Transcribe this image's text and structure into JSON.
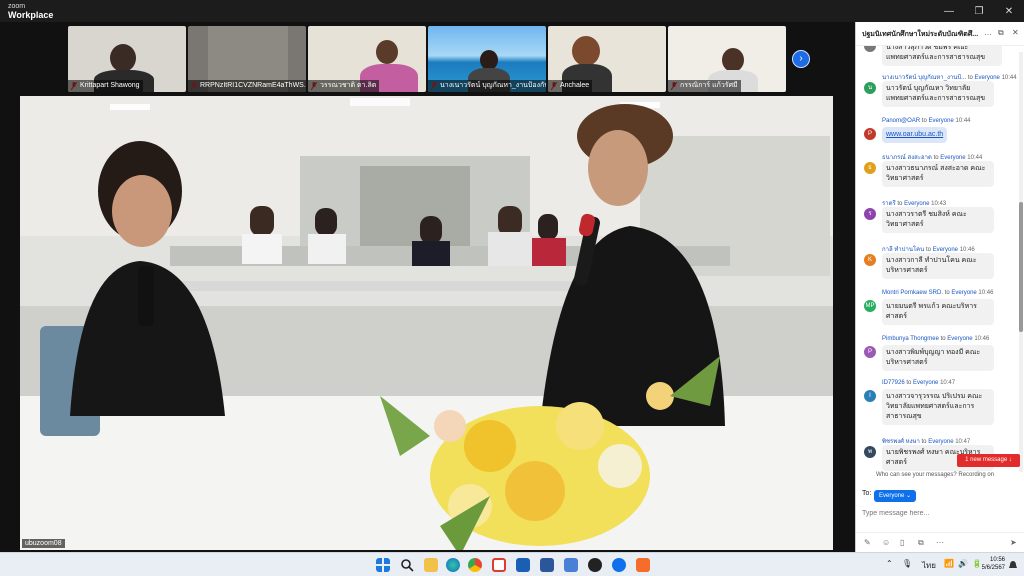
{
  "app": {
    "brand_top": "zoom",
    "brand_bottom": "Workplace"
  },
  "window": {
    "minimize": "—",
    "restore": "❐",
    "close": "✕"
  },
  "participants": [
    {
      "name": "Krittapart Shawong"
    },
    {
      "name": "RRPNzItRI1CVZNRamE4aThWS..."
    },
    {
      "name": "วรรณวชาติ ตา.ลิต"
    },
    {
      "name": "นางเนาวรัตน์ บุญกัณหา_งานป้องกันควบ..."
    },
    {
      "name": "Anchalee"
    },
    {
      "name": "กรรณิการ์ แก้วรัศมี"
    }
  ],
  "next_page_icon": "›",
  "speaker_label": "ubuzoom08",
  "chat": {
    "title": "ปฐมนิเทศนักศึกษาใหม่ระดับบัณฑิตศึ...",
    "header_icons": [
      "…",
      "⧉",
      "✕"
    ],
    "messages": [
      {
        "sender": "",
        "to_label": "",
        "recipient": "",
        "time": "",
        "avatar": "",
        "avatar_color": "#777777",
        "text": "นางสาวสุภาวดี ชมพร คณะ แพทยศาสตร์และการสาธารณสุข"
      },
      {
        "sender": "นางเนาวรัตน์ บุญกัณหา_งานป้...",
        "to_label": "to",
        "recipient": "Everyone",
        "time": "10:44",
        "avatar": "น",
        "avatar_color": "#2e9e5b",
        "text": "นาวรัตน์ บุญกัณหา วิทยาลัยแพทยศาสตร์และการสาธารณสุข"
      },
      {
        "sender": "Panom@OAR",
        "to_label": "to",
        "recipient": "Everyone",
        "time": "10:44",
        "avatar": "P",
        "avatar_color": "#c0392b",
        "text": "www.oar.ubu.ac.th",
        "link": true
      },
      {
        "sender": "ธนาภรณ์ สงสะอาด",
        "to_label": "to",
        "recipient": "Everyone",
        "time": "10:44",
        "avatar": "ธ",
        "avatar_color": "#e0a01b",
        "text": "นางสาวธนาภรณ์ สงสะอาด คณะวิทยาศาสตร์"
      },
      {
        "sender": "ราตรี",
        "to_label": "to",
        "recipient": "Everyone",
        "time": "10:43",
        "avatar": "ร",
        "avatar_color": "#8e44ad",
        "text": "นางสาวราตรี ชมสิงห์ คณะวิทยาศาสตร์"
      },
      {
        "sender": "กาลี ทำปานโคน",
        "to_label": "to",
        "recipient": "Everyone",
        "time": "10:46",
        "avatar": "K",
        "avatar_color": "#e67e22",
        "text": "นางสาวกาลี ทำปานโคน คณะบริหารศาสตร์"
      },
      {
        "sender": "Montri Pornkaew SRD.",
        "to_label": "to",
        "recipient": "Everyone",
        "time": "10:46",
        "avatar": "MP",
        "avatar_color": "#27ae60",
        "text": "นายมนตรี พรแก้ว คณะบริหารศาสตร์"
      },
      {
        "sender": "Pimbunya Thongmee",
        "to_label": "to",
        "recipient": "Everyone",
        "time": "10:46",
        "avatar": "P",
        "avatar_color": "#9b59b6",
        "text": "นางสาวพิมพ์บุญญา ทองมี คณะบริหารศาสตร์"
      },
      {
        "sender": "ID77926",
        "to_label": "to",
        "recipient": "Everyone",
        "time": "10:47",
        "avatar": "I",
        "avatar_color": "#2980b9",
        "text": "นางสาวจารุวรรณ ปริเปรม คณะ วิทยาลัยแพทยศาสตร์และการสาธารณสุข"
      },
      {
        "sender": "พิชรพงศ์ หงษา",
        "to_label": "to",
        "recipient": "Everyone",
        "time": "10:47",
        "avatar": "พ",
        "avatar_color": "#34495e",
        "text": "นายพิชรพงศ์ หงษา คณะบริหารศาสตร์"
      }
    ],
    "new_message": "1 new message ↓",
    "who_can_see": "Who can see your messages? Recording on",
    "to_label": "To:",
    "to_value": "Everyone ⌄",
    "input_placeholder": "Type message here...",
    "tools": [
      "✎",
      "☺",
      "▯",
      "⧉",
      "⋯",
      "➤"
    ]
  },
  "taskbar": {
    "tray_items": [
      "⌃",
      "🎙",
      "ไทย",
      "📶",
      "🔊",
      "🔋"
    ],
    "time": "10:56",
    "date": "5/6/2567"
  }
}
